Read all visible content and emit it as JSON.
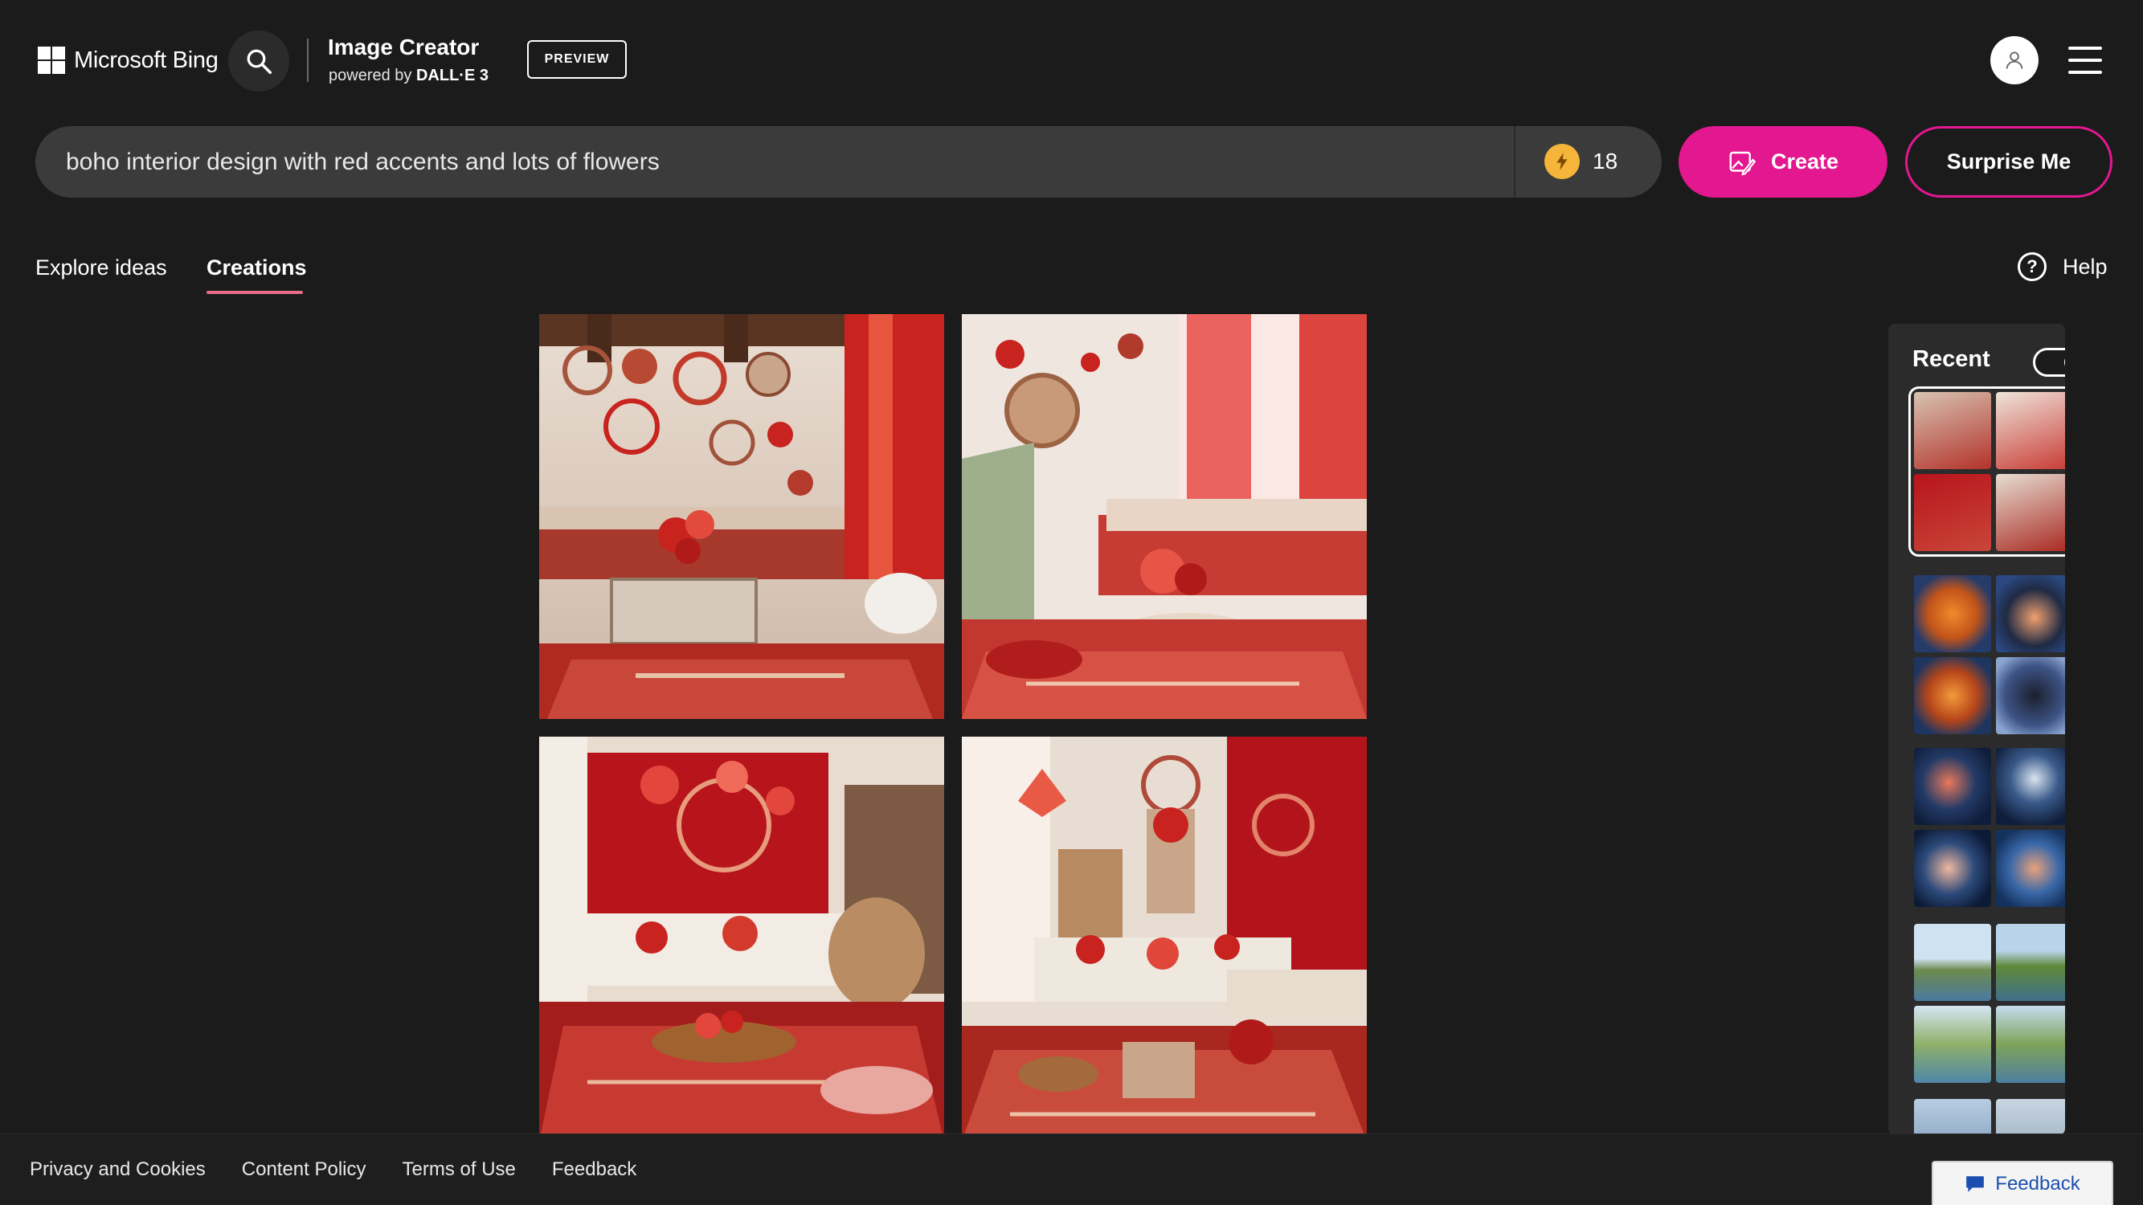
{
  "header": {
    "logo_text": "Microsoft Bing",
    "title": "Image Creator",
    "subtitle_prefix": "powered by",
    "subtitle_model": "DALL·E 3",
    "badge": "PREVIEW"
  },
  "prompt": {
    "value": "boho interior design with red accents and lots of flowers",
    "boosts": "18"
  },
  "actions": {
    "create_label": "Create",
    "surprise_label": "Surprise Me"
  },
  "tabs": [
    {
      "label": "Explore ideas",
      "active": false
    },
    {
      "label": "Creations",
      "active": true
    }
  ],
  "help_label": "Help",
  "recent": {
    "title": "Recent",
    "toggle_on": true
  },
  "footer": {
    "links": [
      "Privacy and Cookies",
      "Content Policy",
      "Terms of Use",
      "Feedback"
    ],
    "feedback_button": "Feedback"
  },
  "colors": {
    "accent": "#e3178f",
    "background": "#1b1b1b",
    "tab_underline": "#e86d87",
    "boost_coin": "#f5b53b"
  }
}
